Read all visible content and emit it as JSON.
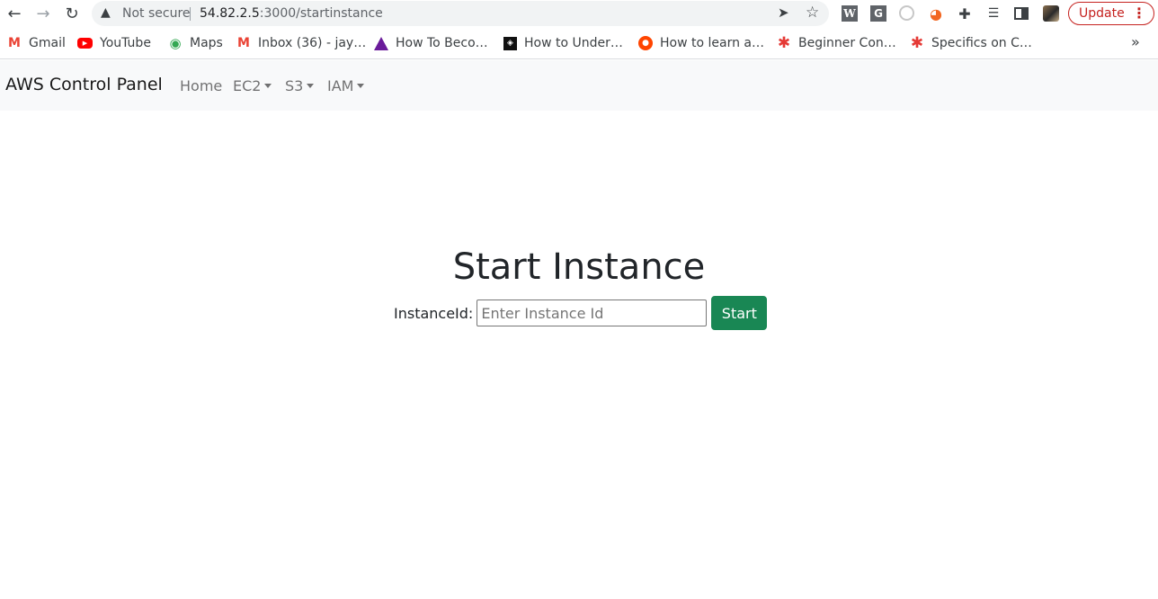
{
  "browser": {
    "not_secure_label": "Not secure",
    "url_host": "54.82.2.5",
    "url_rest": ":3000/startinstance",
    "update_label": "Update",
    "menu_glyph": "⋮",
    "ext_w_label": "W",
    "ext_g_label": "G",
    "bookmarks": [
      {
        "label": "Gmail",
        "icon": "gmail-icon"
      },
      {
        "label": "YouTube",
        "icon": "youtube-icon"
      },
      {
        "label": "Maps",
        "icon": "maps-icon"
      },
      {
        "label": "Inbox (36) - jay…",
        "icon": "gmail-icon"
      },
      {
        "label": "How To Beco…",
        "icon": "triangle-icon"
      },
      {
        "label": "How to Under…",
        "icon": "dark-square-icon"
      },
      {
        "label": "How to learn a…",
        "icon": "reddit-icon"
      },
      {
        "label": "Beginner Con…",
        "icon": "asterisk-icon"
      },
      {
        "label": "Specifics on C…",
        "icon": "asterisk-icon"
      }
    ],
    "more_glyph": "»"
  },
  "navbar": {
    "brand": "AWS Control Panel",
    "links": [
      {
        "label": "Home",
        "dropdown": false
      },
      {
        "label": "EC2",
        "dropdown": true
      },
      {
        "label": "S3",
        "dropdown": true
      },
      {
        "label": "IAM",
        "dropdown": true
      }
    ]
  },
  "main": {
    "title": "Start Instance",
    "field_label": "InstanceId:",
    "field_placeholder": "Enter Instance Id",
    "field_value": "",
    "submit_label": "Start"
  },
  "colors": {
    "start_button": "#198754",
    "navbar_bg": "#f8f9fa",
    "update_accent": "#c5221f"
  }
}
